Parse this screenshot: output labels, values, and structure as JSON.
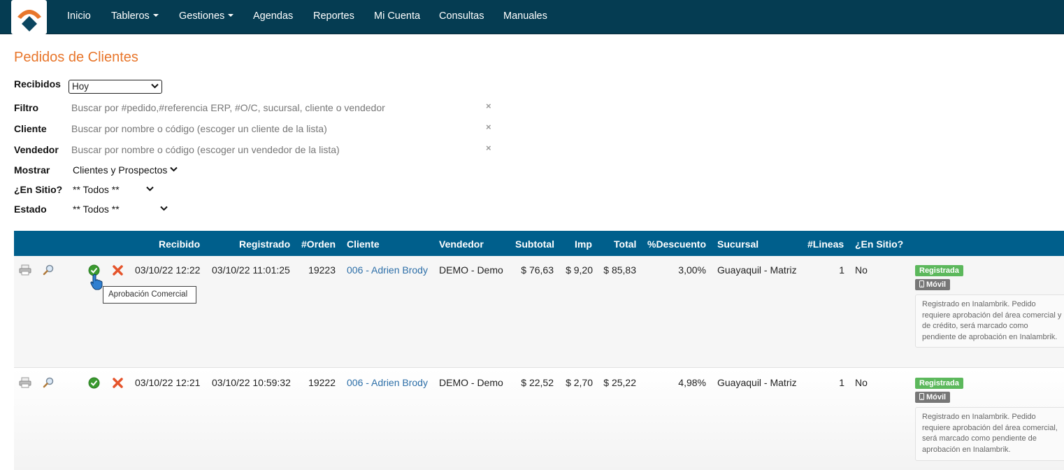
{
  "nav": {
    "items": [
      {
        "label": "Inicio",
        "dropdown": false
      },
      {
        "label": "Tableros",
        "dropdown": true
      },
      {
        "label": "Gestiones",
        "dropdown": true
      },
      {
        "label": "Agendas",
        "dropdown": false
      },
      {
        "label": "Reportes",
        "dropdown": false
      },
      {
        "label": "Mi Cuenta",
        "dropdown": false
      },
      {
        "label": "Consultas",
        "dropdown": false
      },
      {
        "label": "Manuales",
        "dropdown": false
      }
    ]
  },
  "page": {
    "title": "Pedidos de Clientes"
  },
  "filters": {
    "recibidos": {
      "label": "Recibidos",
      "value": "Hoy"
    },
    "filtro": {
      "label": "Filtro",
      "placeholder": "Buscar por #pedido,#referencia ERP, #O/C, sucursal, cliente o vendedor",
      "clear": "×"
    },
    "cliente": {
      "label": "Cliente",
      "placeholder": "Buscar por nombre o código (escoger un cliente de la lista)",
      "clear": "×"
    },
    "vendedor": {
      "label": "Vendedor",
      "placeholder": "Buscar por nombre o código (escoger un vendedor de la lista)",
      "clear": "×"
    },
    "mostrar": {
      "label": "Mostrar",
      "value": "Clientes y Prospectos"
    },
    "en_sitio": {
      "label": "¿En Sitio?",
      "value": "** Todos **"
    },
    "estado": {
      "label": "Estado",
      "value": "** Todos **"
    }
  },
  "table": {
    "columns": [
      "Recibido",
      "Registrado",
      "#Orden",
      "Cliente",
      "Vendedor",
      "Subtotal",
      "Imp",
      "Total",
      "%Descuento",
      "Sucursal",
      "#Lineas",
      "¿En Sitio?"
    ],
    "rows": [
      {
        "recibido": "03/10/22 12:22",
        "registrado": "03/10/22 11:01:25",
        "orden": "19223",
        "cliente": "006 - Adrien Brody",
        "vendedor": "DEMO - Demo",
        "subtotal": "$ 76,63",
        "imp": "$ 9,20",
        "total": "$ 85,83",
        "descuento": "3,00%",
        "sucursal": "Guayaquil - Matriz",
        "lineas": "1",
        "en_sitio": "No",
        "estado": "Registrada",
        "canal": "Móvil",
        "nota": "Registrado en Inalambrik. Pedido requiere aprobación del área comercial y de crédito, será marcado como pendiente de aprobación en Inalambrik."
      },
      {
        "recibido": "03/10/22 12:21",
        "registrado": "03/10/22 10:59:32",
        "orden": "19222",
        "cliente": "006 - Adrien Brody",
        "vendedor": "DEMO - Demo",
        "subtotal": "$ 22,52",
        "imp": "$ 2,70",
        "total": "$ 25,22",
        "descuento": "4,98%",
        "sucursal": "Guayaquil - Matriz",
        "lineas": "1",
        "en_sitio": "No",
        "estado": "Registrada",
        "canal": "Móvil",
        "nota": "Registrado en Inalambrik. Pedido requiere aprobación del área comercial, será marcado como pendiente de aprobación en Inalambrik."
      }
    ]
  },
  "tooltip": {
    "text": "Aprobación Comercial"
  },
  "colors": {
    "navbar": "#053c52",
    "table_header": "#005f8c",
    "title": "#e8762b",
    "link": "#2d6fa8",
    "badge_registrada": "#5cb85c",
    "badge_movil": "#777777"
  }
}
